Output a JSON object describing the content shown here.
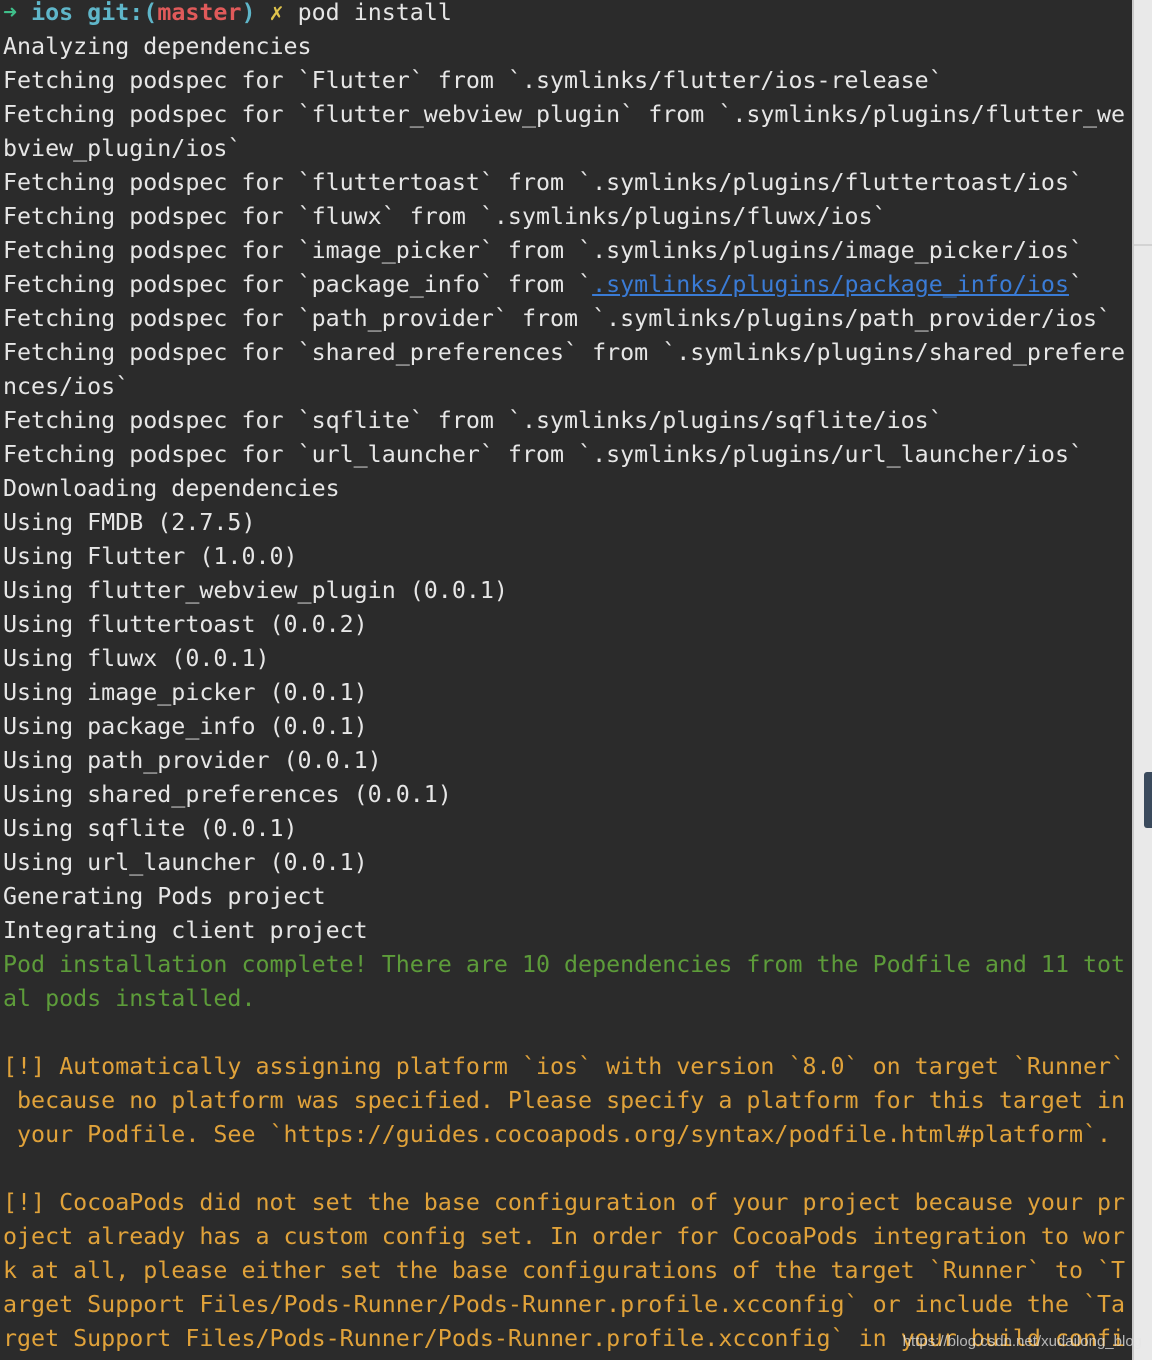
{
  "prompt": {
    "arrow": "➜",
    "dir": "ios",
    "git_label": "git:(",
    "branch": "master",
    "git_close": ")",
    "dirty_mark": "✗",
    "command": "pod install"
  },
  "output": [
    "Analyzing dependencies",
    "Fetching podspec for `Flutter` from `.symlinks/flutter/ios-release`",
    "Fetching podspec for `flutter_webview_plugin` from `.symlinks/plugins/flutter_we",
    "bview_plugin/ios`",
    "Fetching podspec for `fluttertoast` from `.symlinks/plugins/fluttertoast/ios`",
    "Fetching podspec for `fluwx` from `.symlinks/plugins/fluwx/ios`",
    "Fetching podspec for `image_picker` from `.symlinks/plugins/image_picker/ios`"
  ],
  "link_line": {
    "prefix": "Fetching podspec for `package_info` from `",
    "link": ".symlinks/plugins/package_info/ios",
    "suffix": "`"
  },
  "output2": [
    "Fetching podspec for `path_provider` from `.symlinks/plugins/path_provider/ios`",
    "Fetching podspec for `shared_preferences` from `.symlinks/plugins/shared_prefere",
    "nces/ios`",
    "Fetching podspec for `sqflite` from `.symlinks/plugins/sqflite/ios`",
    "Fetching podspec for `url_launcher` from `.symlinks/plugins/url_launcher/ios`",
    "Downloading dependencies",
    "Using FMDB (2.7.5)",
    "Using Flutter (1.0.0)",
    "Using flutter_webview_plugin (0.0.1)",
    "Using fluttertoast (0.0.2)",
    "Using fluwx (0.0.1)",
    "Using image_picker (0.0.1)",
    "Using package_info (0.0.1)",
    "Using path_provider (0.0.1)",
    "Using shared_preferences (0.0.1)",
    "Using sqflite (0.0.1)",
    "Using url_launcher (0.0.1)",
    "Generating Pods project",
    "Integrating client project"
  ],
  "success": [
    "Pod installation complete! There are 10 dependencies from the Podfile and 11 tot",
    "al pods installed."
  ],
  "warning1": [
    "[!] Automatically assigning platform `ios` with version `8.0` on target `Runner`",
    " because no platform was specified. Please specify a platform for this target in",
    " your Podfile. See `https://guides.cocoapods.org/syntax/podfile.html#platform`."
  ],
  "warning2": [
    "[!] CocoaPods did not set the base configuration of your project because your pr",
    "oject already has a custom config set. In order for CocoaPods integration to wor",
    "k at all, please either set the base configurations of the target `Runner` to `T",
    "arget Support Files/Pods-Runner/Pods-Runner.profile.xcconfig` or include the `Ta",
    "rget Support Files/Pods-Runner/Pods-Runner.profile.xcconfig` in your build confi"
  ],
  "watermark": "https://blog.csdn.net/xudailong_blog"
}
